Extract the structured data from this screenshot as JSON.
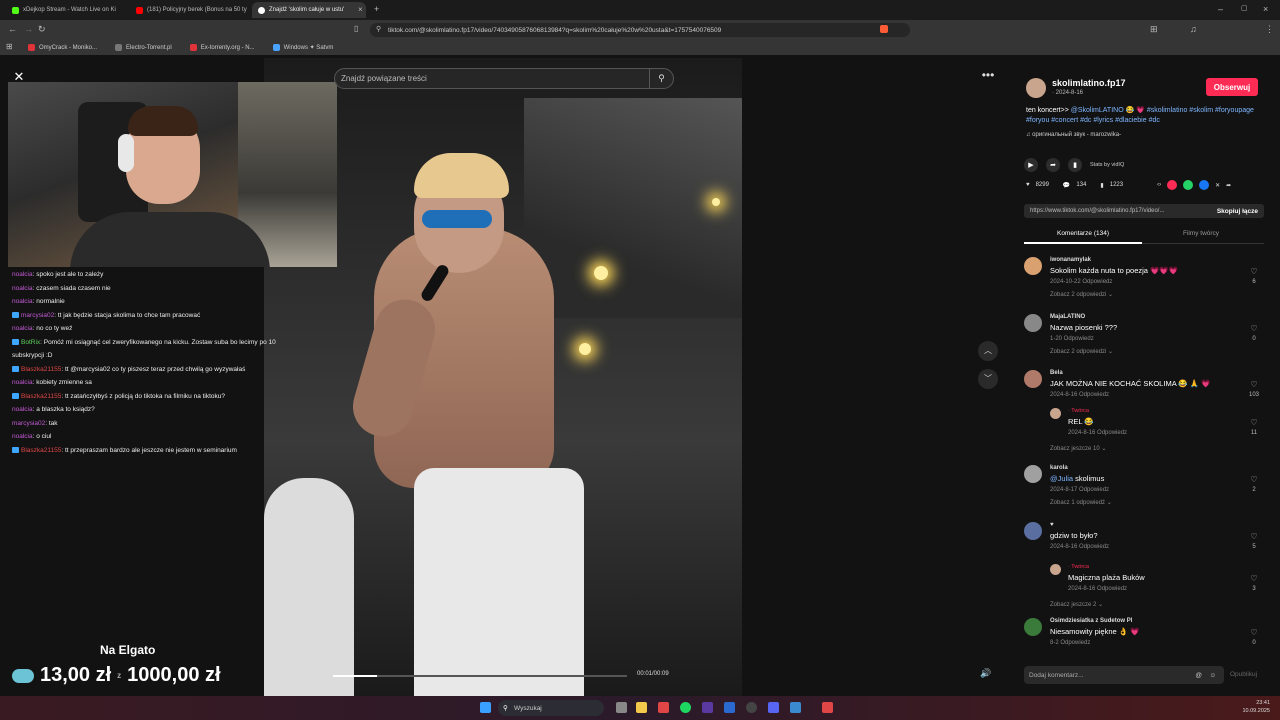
{
  "browser": {
    "tabs": [
      {
        "title": "xDejkop Stream - Watch Live on Ki",
        "color": "#53fc18"
      },
      {
        "title": "(181) Policyjny berek (Bonus na 50 ty",
        "color": "#ff0000"
      },
      {
        "title": "Znajdź 'skolim całuje w ustu'",
        "color": "#ffffff"
      }
    ],
    "url": "tiktok.com/@skolimlatino.fp17/video/7403490587606813984?q=skolim%20całuje%20w%20usta&t=1757540076509",
    "bookmarks": [
      "OmyCrack - Moniko...",
      "Electro-Torrent.pl",
      "Ex-torrenty.org - N...",
      "Windows ✦ Satvm"
    ]
  },
  "stream": {
    "chat": [
      {
        "user": "noalcia",
        "text": "spoko jest ale to zależy",
        "color": "pink",
        "badge": false
      },
      {
        "user": "noalcia",
        "text": "czasem siada czasem nie",
        "color": "pink",
        "badge": false
      },
      {
        "user": "noalcia",
        "text": "normalnie",
        "color": "pink",
        "badge": false
      },
      {
        "user": "marcysia02",
        "text": "tt jak będzie stacja skolima to chce tam pracować",
        "color": "pink",
        "badge": true
      },
      {
        "user": "noalcia",
        "text": "no co ty weź",
        "color": "pink",
        "badge": false
      },
      {
        "user": "BotRix",
        "text": "Pomóż mi osiągnąć cel zweryfikowanego na kicku. Zostaw suba bo lecimy po 10",
        "color": "green",
        "badge": true
      },
      {
        "user": "",
        "text": "subskrypcji :D",
        "color": "none",
        "badge": false
      },
      {
        "user": "Blaszka21155",
        "text": "tt @marcysia02 co ty piszesz teraz przed chwilą go wyzywałaś",
        "color": "red",
        "badge": true
      },
      {
        "user": "noalcia",
        "text": "kobiety zmienne sa",
        "color": "pink",
        "badge": false
      },
      {
        "user": "Blaszka21155",
        "text": "tt zatańczyłbyś z policją do tiktoka na filmiku na tiktoku?",
        "color": "red",
        "badge": true
      },
      {
        "user": "noalcia",
        "text": "a blaszka to ksiądz?",
        "color": "pink",
        "badge": false
      },
      {
        "user": "marcysia02",
        "text": "tak",
        "color": "pink",
        "badge": false
      },
      {
        "user": "noalcia",
        "text": "o ciul",
        "color": "pink",
        "badge": false
      },
      {
        "user": "Blaszka21155",
        "text": "tt przepraszam bardzo ale jeszcze nie jestem w seminarium",
        "color": "red",
        "badge": true
      }
    ],
    "elgato_label": "Na Elgato",
    "donation_current": "13,00 zł",
    "donation_sep": "z",
    "donation_goal": "1000,00 zł"
  },
  "video": {
    "search_placeholder": "Znajdź powiązane treści",
    "timecode": "00:01/00:09",
    "progress": 0.15
  },
  "panel": {
    "username": "skolimlatino.fp17",
    "date": "· 2024-8-16",
    "follow_label": "Obserwuj",
    "desc_text": "ten koncert>> ",
    "desc_tags": "@SkolimLATINO 😂 💗 #skolimlatino #skolim #foryoupage #foryou #concert #dc #lyrics #dlaciebie #dc",
    "sound": "♫ оригинальный звук - marozwika-",
    "stats_label": "Stats by vidIQ",
    "likes": "8299",
    "comments": "134",
    "saves": "1223",
    "link": "https://www.tiktok.com/@skolimlatino.fp17/video/...",
    "copy_link": "Skopiuj łącze",
    "tab_comments": "Komentarze (134)",
    "tab_creator": "Filmy twórcy",
    "add_comment": "Dodaj komentarz...",
    "publish": "Opublikuj",
    "comments_list": [
      {
        "user": "iwonanamylak",
        "text": "Sokolim każda nuta to poezja 💗💗💗",
        "meta": "2024-10-22   Odpowiedz",
        "more": "Zobacz 2 odpowiedzi ⌄",
        "likes": "6",
        "avatar": "#d9a070"
      },
      {
        "user": "MajaLATINO",
        "text": "Nazwa piosenki ???",
        "meta": "1-20   Odpowiedz",
        "more": "Zobacz 2 odpowiedzi ⌄",
        "likes": "0",
        "avatar": "#888888"
      },
      {
        "user": "Bela",
        "text": "JAK MOŻNA NIE KOCHAĆ SKOLIMA 😂 🙏 💗",
        "meta": "2024-8-16   Odpowiedz",
        "more": "",
        "likes": "103",
        "avatar": "#b07a6a"
      },
      {
        "user": "karola",
        "text": "skolimus",
        "mention": "@Julia",
        "meta": "2024-8-17   Odpowiedz",
        "more": "Zobacz 1 odpowiedź ⌄",
        "likes": "2",
        "avatar": "#a0a0a0"
      },
      {
        "user": "♥",
        "text": "gdziw to było?",
        "meta": "2024-8-16   Odpowiedz",
        "more": "",
        "likes": "5",
        "avatar": "#5a6fa0"
      },
      {
        "user": "Osimdziesiatka z Sudetow Pl",
        "text": "Niesamowity piękne 👌 💗",
        "meta": "8-2   Odpowiedz",
        "more": "",
        "likes": "0",
        "avatar": "#3a7a3a"
      }
    ],
    "replies": [
      {
        "author": "· Twórca",
        "text": "REL 😂",
        "meta": "2024-8-16   Odpowiedz",
        "more": "Zobacz jeszcze 10 ⌄",
        "likes": "11"
      },
      {
        "author": "· Twórca",
        "text": "Magiczna plaża Buków",
        "meta": "2024-8-16   Odpowiedz",
        "more": "Zobacz jeszcze 2 ⌄",
        "likes": "3"
      }
    ]
  },
  "taskbar": {
    "search": "Wyszukaj",
    "time": "23:41",
    "date": "10.09.2025"
  }
}
